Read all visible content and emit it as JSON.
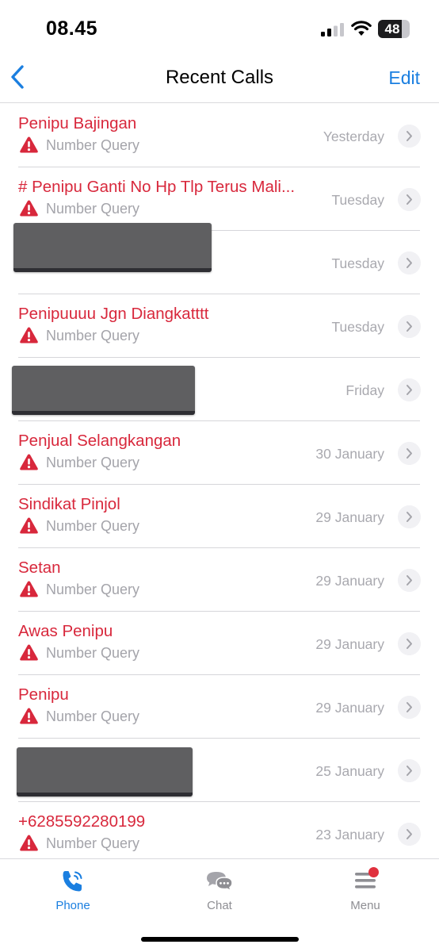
{
  "status_bar": {
    "time": "08.45",
    "battery": "48"
  },
  "nav": {
    "title": "Recent Calls",
    "edit_label": "Edit"
  },
  "calls": [
    {
      "name": "Penipu Bajingan",
      "sub": "Number Query",
      "date": "Yesterday"
    },
    {
      "name": "# Penipu Ganti No Hp Tlp Terus Mali...",
      "sub": "Number Query",
      "date": "Tuesday"
    },
    {
      "name": "",
      "sub": "",
      "date": "Tuesday"
    },
    {
      "name": "Penipuuuu Jgn Diangkatttt",
      "sub": "Number Query",
      "date": "Tuesday"
    },
    {
      "name": "",
      "sub": "",
      "date": "Friday"
    },
    {
      "name": "Penjual Selangkangan",
      "sub": "Number Query",
      "date": "30 January"
    },
    {
      "name": "Sindikat Pinjol",
      "sub": "Number Query",
      "date": "29 January"
    },
    {
      "name": "Setan",
      "sub": "Number Query",
      "date": "29 January"
    },
    {
      "name": "Awas Penipu",
      "sub": "Number Query",
      "date": "29 January"
    },
    {
      "name": "Penipu",
      "sub": "Number Query",
      "date": "29 January"
    },
    {
      "name": "",
      "sub": "",
      "date": "25 January"
    },
    {
      "name": "+6285592280199",
      "sub": "Number Query",
      "date": "23 January"
    }
  ],
  "tabs": [
    {
      "label": "Phone",
      "icon": "phone-icon"
    },
    {
      "label": "Chat",
      "icon": "chat-bubbles-icon"
    },
    {
      "label": "Menu",
      "icon": "menu-icon"
    }
  ],
  "colors": {
    "accent": "#1b7fe0",
    "spam": "#d8283c",
    "secondary": "#a4a4aa"
  }
}
